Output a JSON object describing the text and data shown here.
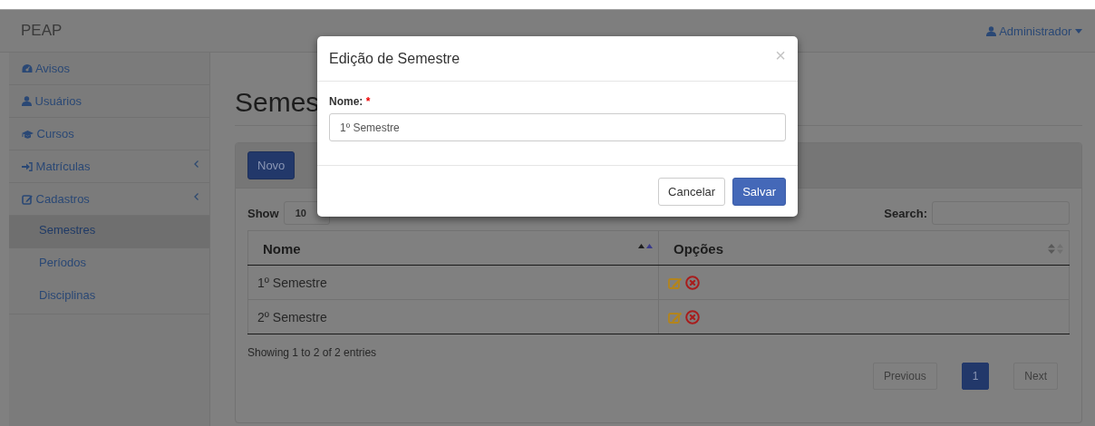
{
  "navbar": {
    "brand": "PEAP",
    "user": "Administrador"
  },
  "sidebar": {
    "items": [
      {
        "label": "Avisos",
        "selected": false,
        "kind": "link"
      },
      {
        "label": "Usuários",
        "selected": false,
        "kind": "link"
      },
      {
        "label": "Cursos",
        "selected": false,
        "kind": "link"
      },
      {
        "label": "Matrículas",
        "selected": false,
        "kind": "submenu"
      },
      {
        "label": "Cadastros",
        "selected": false,
        "kind": "submenu",
        "children": [
          {
            "label": "Semestres",
            "selected": true
          },
          {
            "label": "Períodos",
            "selected": false
          },
          {
            "label": "Disciplinas",
            "selected": false
          }
        ]
      }
    ]
  },
  "page": {
    "title": "Semes"
  },
  "panel": {
    "new_button": "Novo",
    "show_label": "Show",
    "page_length": "10",
    "search_label": "Search:",
    "table": {
      "columns": [
        {
          "label": "Nome",
          "sorted": true
        },
        {
          "label": "Opções",
          "sorted": false
        }
      ],
      "rows": [
        {
          "nome": "1º Semestre"
        },
        {
          "nome": "2º Semestre"
        }
      ]
    },
    "info": "Showing 1 to 2 of 2 entries",
    "pagination": [
      {
        "label": "Previous",
        "selected": false,
        "disabled": true
      },
      {
        "label": "1",
        "selected": true,
        "disabled": false
      },
      {
        "label": "Next",
        "selected": false,
        "disabled": true
      }
    ]
  },
  "modal": {
    "title": "Edição de Semestre",
    "close": "×",
    "field": {
      "label": "Nome:",
      "required_mark": "*",
      "value": "1º Semestre"
    },
    "buttons": [
      {
        "label": "Cancelar",
        "kind": "default"
      },
      {
        "label": "Salvar",
        "kind": "primary"
      }
    ]
  }
}
